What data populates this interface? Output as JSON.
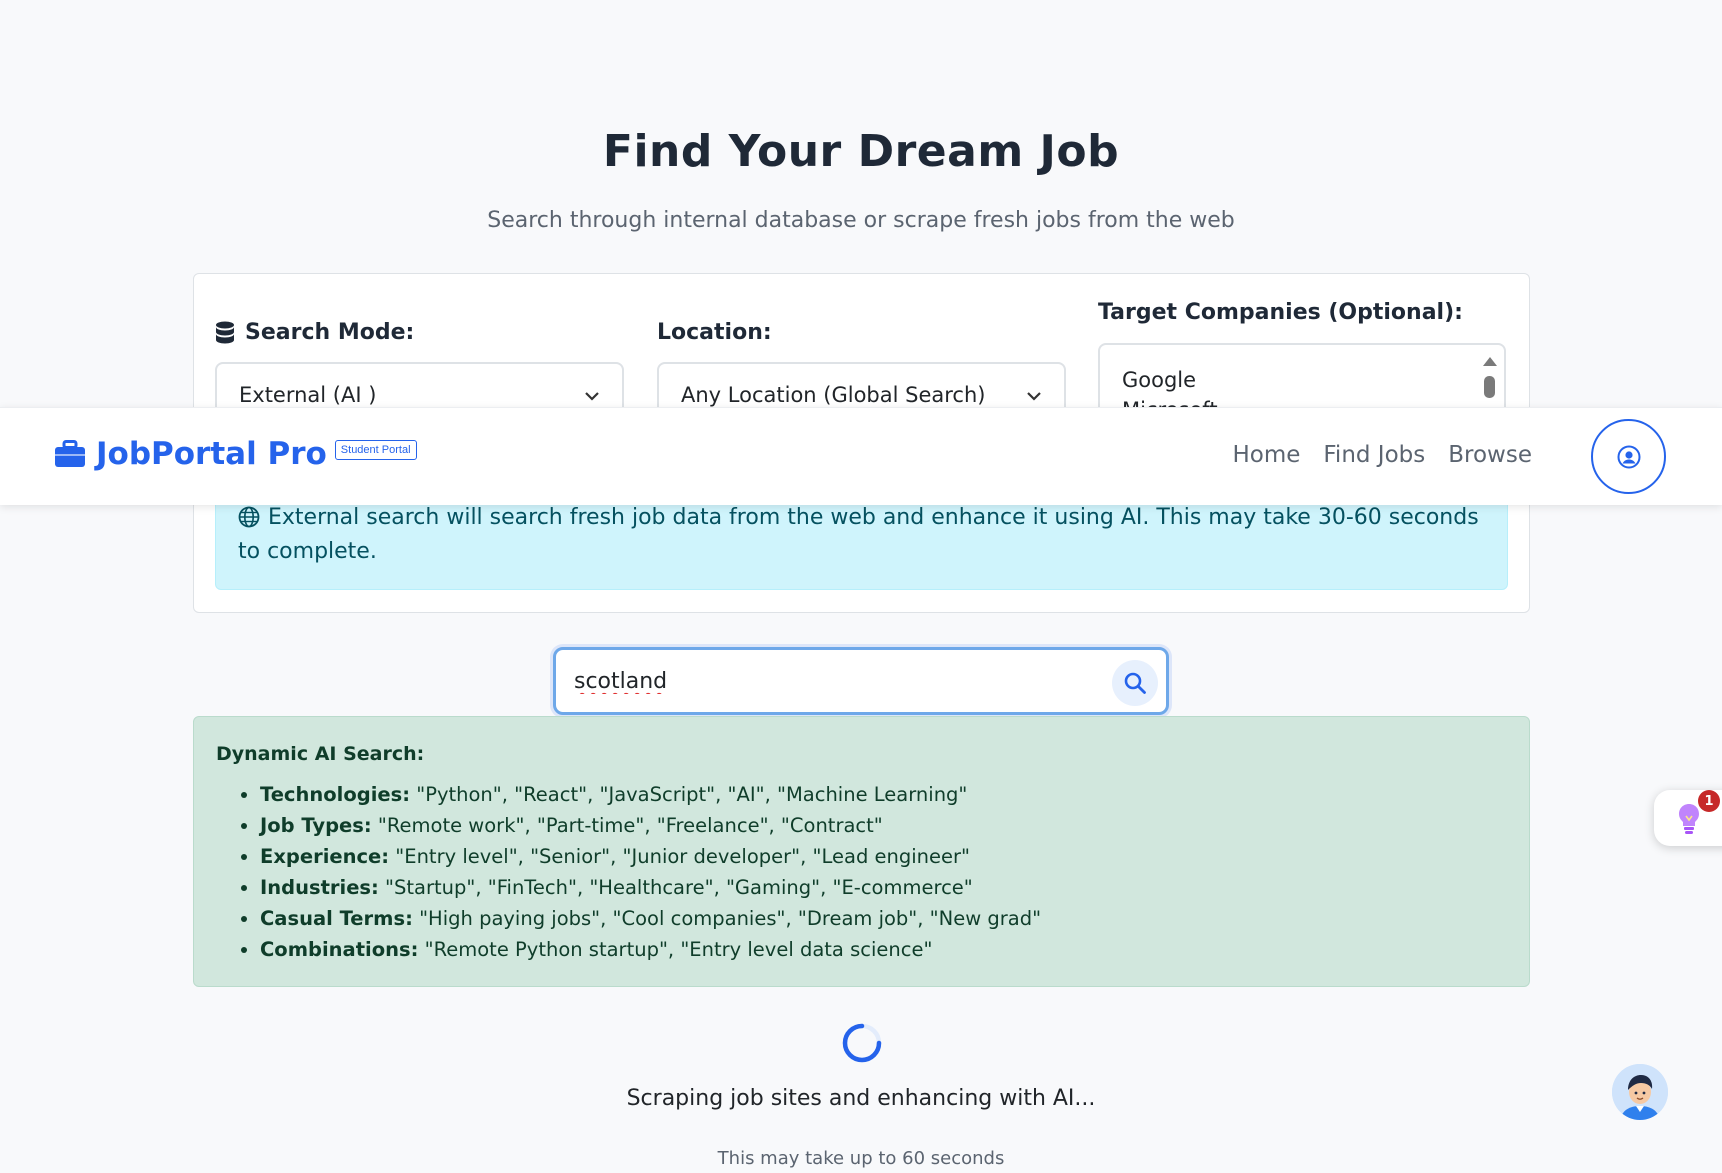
{
  "hero": {
    "title": "Find Your Dream Job",
    "subtitle": "Search through internal database or scrape fresh jobs from the web"
  },
  "filters": {
    "search_mode_label": "Search Mode:",
    "search_mode_value": "External (AI )",
    "location_label": "Location:",
    "location_value": "Any Location (Global Search)",
    "companies_label": "Target Companies (Optional):",
    "companies_options": [
      "Google",
      "Microsoft"
    ]
  },
  "alert": {
    "text": "External search will search fresh job data from the web and enhance it using AI. This may take 30-60 seconds to complete."
  },
  "navbar": {
    "brand": "JobPortal Pro",
    "badge": "Student Portal",
    "links": [
      "Home",
      "Find Jobs",
      "Browse"
    ]
  },
  "search": {
    "query": "scotland"
  },
  "help": {
    "title": "Dynamic AI Search:",
    "items": [
      {
        "term": "Technologies:",
        "examples": "\"Python\", \"React\", \"JavaScript\", \"AI\", \"Machine Learning\""
      },
      {
        "term": "Job Types:",
        "examples": "\"Remote work\", \"Part-time\", \"Freelance\", \"Contract\""
      },
      {
        "term": "Experience:",
        "examples": "\"Entry level\", \"Senior\", \"Junior developer\", \"Lead engineer\""
      },
      {
        "term": "Industries:",
        "examples": "\"Startup\", \"FinTech\", \"Healthcare\", \"Gaming\", \"E-commerce\""
      },
      {
        "term": "Casual Terms:",
        "examples": "\"High paying jobs\", \"Cool companies\", \"Dream job\", \"New grad\""
      },
      {
        "term": "Combinations:",
        "examples": "\"Remote Python startup\", \"Entry level data science\""
      }
    ]
  },
  "loading": {
    "text": "Scraping job sites and enhancing with AI...",
    "subtext": "This may take up to 60 seconds"
  },
  "widget": {
    "badge_count": "1"
  },
  "colors": {
    "primary": "#2563eb",
    "info_bg": "#cff4fc",
    "success_bg": "#d1e7dd",
    "badge_red": "#c62828"
  }
}
